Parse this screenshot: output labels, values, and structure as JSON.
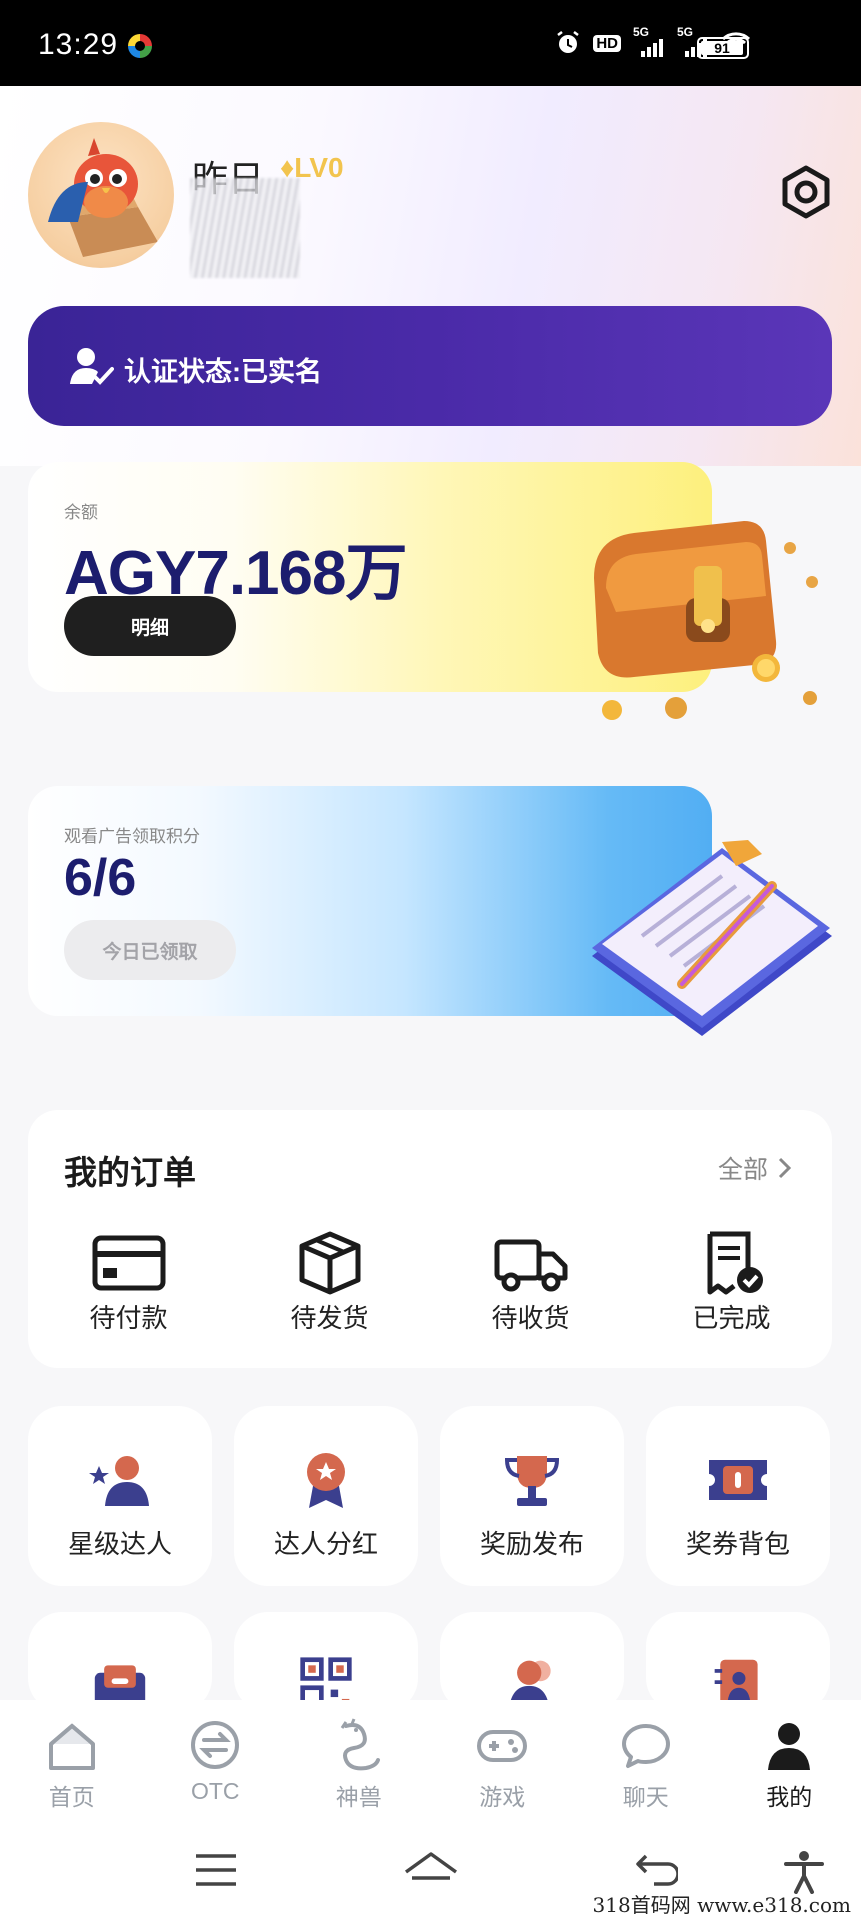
{
  "status_bar": {
    "time": "13:29",
    "hd_label": "HD",
    "net1": "5G",
    "net2": "5G",
    "battery": "91"
  },
  "profile": {
    "username": "昨日",
    "level": "LV0"
  },
  "auth": {
    "label": "认证状态:已实名"
  },
  "balance": {
    "label": "余额",
    "amount": "AGY7.168万",
    "detail_button": "明细"
  },
  "ad_reward": {
    "label": "观看广告领取积分",
    "count": "6/6",
    "claim_button": "今日已领取"
  },
  "orders": {
    "title": "我的订单",
    "all_label": "全部",
    "items": [
      {
        "label": "待付款",
        "icon": "card-icon"
      },
      {
        "label": "待发货",
        "icon": "box-icon"
      },
      {
        "label": "待收货",
        "icon": "truck-icon"
      },
      {
        "label": "已完成",
        "icon": "receipt-check-icon"
      }
    ]
  },
  "features": [
    {
      "label": "星级达人",
      "icon": "star-user-icon"
    },
    {
      "label": "达人分红",
      "icon": "medal-icon"
    },
    {
      "label": "奖励发布",
      "icon": "trophy-icon"
    },
    {
      "label": "奖券背包",
      "icon": "ticket-icon"
    }
  ],
  "features_row2": [
    {
      "icon": "mail-tray-icon"
    },
    {
      "icon": "qr-code-icon"
    },
    {
      "icon": "team-icon"
    },
    {
      "icon": "contact-book-icon"
    }
  ],
  "bottom_nav": [
    {
      "label": "首页",
      "icon": "home-icon"
    },
    {
      "label": "OTC",
      "icon": "exchange-icon"
    },
    {
      "label": "神兽",
      "icon": "dragon-icon"
    },
    {
      "label": "游戏",
      "icon": "gamepad-icon"
    },
    {
      "label": "聊天",
      "icon": "chat-icon"
    },
    {
      "label": "我的",
      "icon": "user-icon",
      "active": true
    }
  ],
  "watermark": "318首码网 www.e318.com",
  "colors": {
    "auth_banner": "#4a2aa8",
    "balance_text": "#1c1d6e",
    "detail_button": "#1f1f1f"
  }
}
